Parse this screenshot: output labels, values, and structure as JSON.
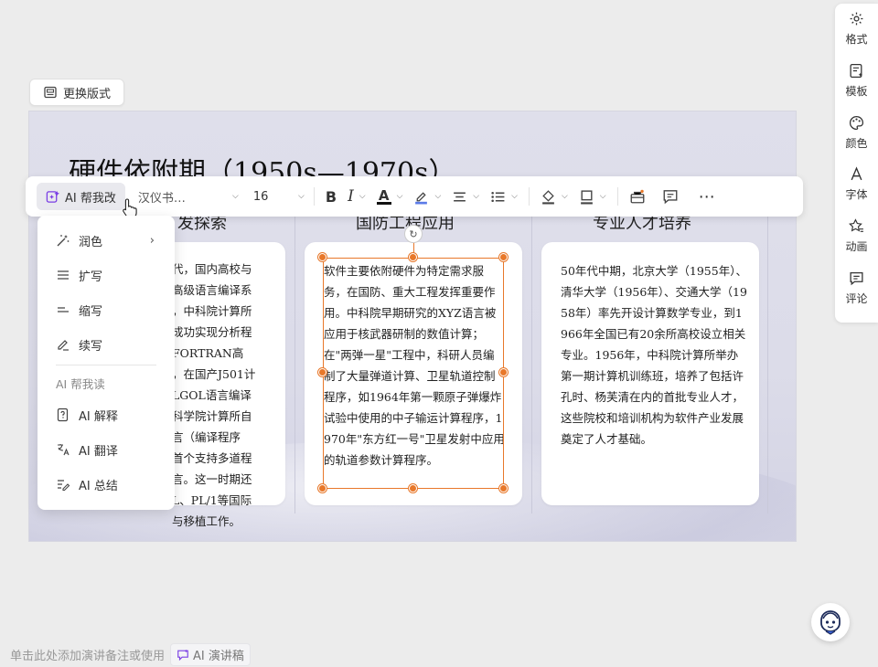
{
  "change_layout": {
    "label": "更换版式",
    "icon": "layout-icon"
  },
  "slide": {
    "title": "硬件依附期（1950s—1970s）",
    "columns": [
      {
        "heading": "发探索"
      },
      {
        "heading": "国防工程应用"
      },
      {
        "heading": "专业人才培养"
      }
    ],
    "card1_lines": [
      "代，国内高校与",
      "高级语言编译系",
      "，中科院计算所",
      "成功实现分析程",
      "FORTRAN高",
      "，在国产J501计",
      "LGOL语言编译",
      "科学院计算所自",
      "言（编译程序",
      "首个支持多道程",
      "言。这一时期还",
      "L、PL/1等国际",
      "与移植工作。"
    ],
    "card2_text": "软件主要依附硬件为特定需求服务，在国防、重大工程发挥重要作用。中科院早期研究的XYZ语言被应用于核武器研制的数值计算；在\"两弹一星\"工程中，科研人员编制了大量弹道计算、卫星轨道控制程序，如1964年第一颗原子弹爆炸试验中使用的中子输运计算程序，1970年\"东方红一号\"卫星发射中应用的轨道参数计算程序。",
    "card3_text": "50年代中期，北京大学（1955年）、清华大学（1956年）、交通大学（1958年）率先开设计算数学专业，到1966年全国已有20余所高校设立相关专业。1956年，中科院计算所举办第一期计算机训练班，培养了包括许孔时、杨芙清在内的首批专业人才，这些院校和培训机构为软件产业发展奠定了人才基础。"
  },
  "toolbar": {
    "ai_label": "AI 帮我改",
    "font_name": "汉仪书…",
    "font_size": "16",
    "bold": "B",
    "italic": "I",
    "font_color": "A",
    "accent_color": "#7b3fe4",
    "selection_color": "#e8782a",
    "icons": [
      "highlight-icon",
      "align-icon",
      "list-icon",
      "fill-icon",
      "border-icon",
      "toolbox-icon",
      "comment-icon",
      "more-icon"
    ]
  },
  "ai_menu": {
    "items": [
      {
        "label": "润色",
        "icon": "wand-icon",
        "has_submenu": true
      },
      {
        "label": "扩写",
        "icon": "expand-icon"
      },
      {
        "label": "缩写",
        "icon": "shorten-icon"
      },
      {
        "label": "续写",
        "icon": "continue-icon"
      }
    ],
    "section_title": "AI 帮我读",
    "read_items": [
      {
        "label": "AI 解释",
        "icon": "explain-icon"
      },
      {
        "label": "AI 翻译",
        "icon": "translate-icon"
      },
      {
        "label": "AI 总结",
        "icon": "summary-icon"
      }
    ]
  },
  "right_panel": {
    "items": [
      {
        "label": "格式",
        "icon": "gear-icon"
      },
      {
        "label": "模板",
        "icon": "template-icon"
      },
      {
        "label": "颜色",
        "icon": "palette-icon"
      },
      {
        "label": "字体",
        "icon": "font-icon"
      },
      {
        "label": "动画",
        "icon": "animation-icon"
      },
      {
        "label": "评论",
        "icon": "comment-icon"
      }
    ]
  },
  "notes": {
    "placeholder": "单击此处添加演讲备注或使用",
    "ai_speech": "AI 演讲稿"
  }
}
